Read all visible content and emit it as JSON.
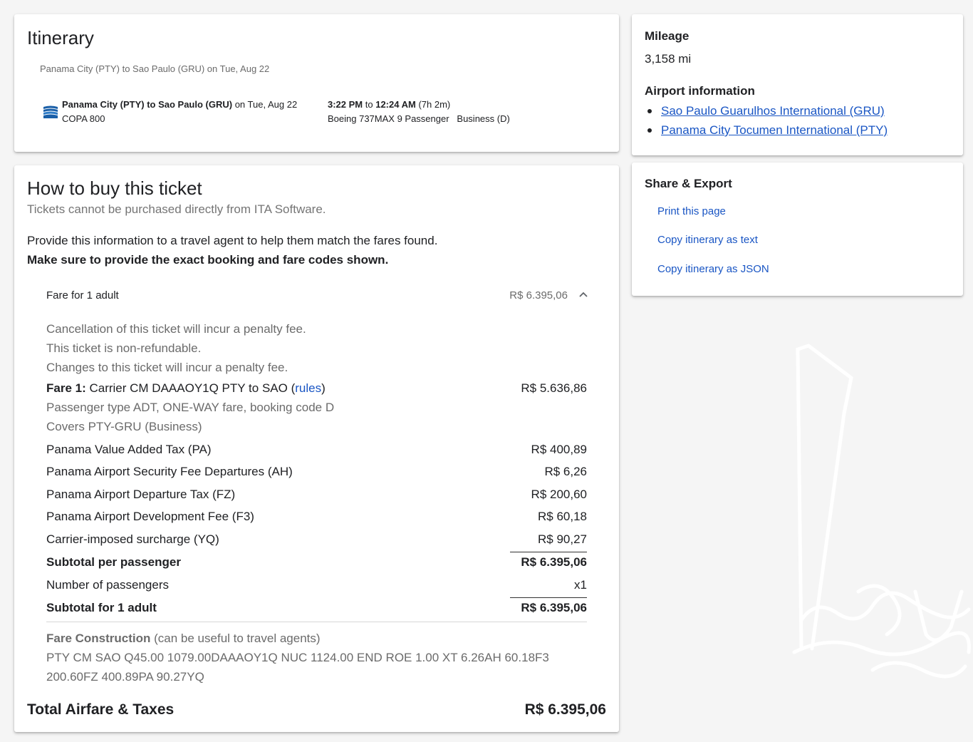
{
  "itinerary": {
    "title": "Itinerary",
    "route_summary": "Panama City (PTY) to Sao Paulo (GRU) on Tue, Aug 22",
    "segment": {
      "route_bold": "Panama City (PTY) to Sao Paulo (GRU)",
      "route_date": " on Tue, Aug 22",
      "flight": "COPA 800",
      "depart": "3:22 PM",
      "to_word": " to ",
      "arrive": "12:24 AM",
      "duration": " (7h 2m)",
      "aircraft": "Boeing 737MAX 9 Passenger",
      "cabin": "Business (D)",
      "logo_icon": "copa-airlines-logo-icon",
      "logo_color": "#1a5fa8"
    }
  },
  "how_to_buy": {
    "title": "How to buy this ticket",
    "subtitle": "Tickets cannot be purchased directly from ITA Software.",
    "info": "Provide this information to a travel agent to help them match the fares found.",
    "info_bold": "Make sure to provide the exact booking and fare codes shown.",
    "fare_header": {
      "label": "Fare for 1 adult",
      "amount": "R$ 6.395,06",
      "toggle_icon": "chevron-up-icon"
    },
    "conditions": [
      "Cancellation of this ticket will incur a penalty fee.",
      "This ticket is non-refundable.",
      "Changes to this ticket will incur a penalty fee."
    ],
    "fare1": {
      "label_bold": "Fare 1:",
      "label": " Carrier CM DAAAOY1Q PTY to SAO (",
      "rules_link": "rules",
      "label_end": ")",
      "amount": "R$ 5.636,86",
      "detail1": "Passenger type ADT, ONE-WAY fare, booking code D",
      "detail2": "Covers PTY-GRU (Business)"
    },
    "taxes": [
      {
        "label": "Panama Value Added Tax (PA)",
        "amount": "R$ 400,89"
      },
      {
        "label": "Panama Airport Security Fee Departures (AH)",
        "amount": "R$ 6,26"
      },
      {
        "label": "Panama Airport Departure Tax (FZ)",
        "amount": "R$ 200,60"
      },
      {
        "label": "Panama Airport Development Fee (F3)",
        "amount": "R$ 60,18"
      },
      {
        "label": "Carrier-imposed surcharge (YQ)",
        "amount": "R$ 90,27"
      }
    ],
    "subtotal_per_passenger": {
      "label": "Subtotal per passenger",
      "amount": "R$ 6.395,06"
    },
    "passengers": {
      "label": "Number of passengers",
      "amount": "x1"
    },
    "subtotal_adult": {
      "label": "Subtotal for 1 adult",
      "amount": "R$ 6.395,06"
    },
    "fare_construction": {
      "label_bold": "Fare Construction",
      "label": " (can be useful to travel agents)",
      "line1": "PTY CM SAO Q45.00 1079.00DAAAOY1Q NUC 1124.00 END ROE 1.00 XT 6.26AH 60.18F3",
      "line2": "200.60FZ 400.89PA 90.27YQ"
    },
    "total": {
      "label": "Total Airfare & Taxes",
      "amount": "R$ 6.395,06"
    }
  },
  "mileage": {
    "title": "Mileage",
    "value": "3,158 mi",
    "airports_title": "Airport information",
    "airports": [
      "Sao Paulo Guarulhos International (GRU)",
      "Panama City Tocumen International (PTY)"
    ]
  },
  "share": {
    "title": "Share & Export",
    "links": [
      "Print this page",
      "Copy itinerary as text",
      "Copy itinerary as JSON"
    ]
  },
  "colors": {
    "link": "#1a56c4",
    "background": "#f5f5f5",
    "card": "#ffffff"
  }
}
